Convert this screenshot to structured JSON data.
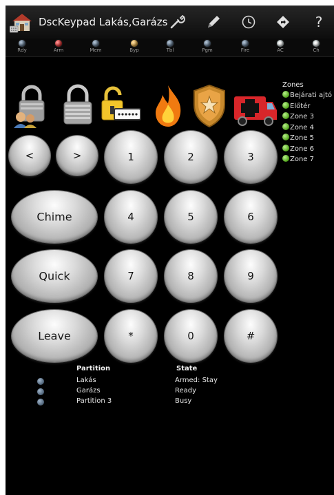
{
  "appbar": {
    "title": "DscKeypad Lakás,Garázs",
    "icons": [
      "app-icon",
      "wrench-icon",
      "pencil-icon",
      "clock-icon",
      "navigation-icon",
      "help-icon"
    ],
    "help_label": "?"
  },
  "indicators": [
    {
      "label": "Rdy",
      "color": "#5a6f85"
    },
    {
      "label": "Arm",
      "color": "#d42a2a"
    },
    {
      "label": "Mem",
      "color": "#5a6f85"
    },
    {
      "label": "Byp",
      "color": "#d9a441"
    },
    {
      "label": "Tbl",
      "color": "#5a6f85"
    },
    {
      "label": "Pgm",
      "color": "#5a6f85"
    },
    {
      "label": "Fire",
      "color": "#5a6f85"
    },
    {
      "label": "AC",
      "color": "#ffffff"
    },
    {
      "label": "Ch",
      "color": "#ffffff"
    }
  ],
  "actions": [
    "arm-stay-icon",
    "arm-away-icon",
    "code-entry-icon",
    "fire-icon",
    "police-icon",
    "ambulance-icon"
  ],
  "zones": {
    "title": "Zones",
    "items": [
      "Bejárati ajtó",
      "Előtér",
      "Zone 3",
      "Zone 4",
      "Zone 5",
      "Zone 6",
      "Zone 7"
    ]
  },
  "keypad": {
    "prev": "<",
    "next": ">",
    "k1": "1",
    "k2": "2",
    "k3": "3",
    "k4": "4",
    "k5": "5",
    "k6": "6",
    "k7": "7",
    "k8": "8",
    "k9": "9",
    "star": "*",
    "k0": "0",
    "hash": "#",
    "chime": "Chime",
    "quick": "Quick",
    "leave": "Leave"
  },
  "partitions": {
    "col_partition": "Partition",
    "col_state": "State",
    "rows": [
      {
        "name": "Lakás",
        "state": "Armed: Stay"
      },
      {
        "name": "Garázs",
        "state": "Ready"
      },
      {
        "name": "Partition 3",
        "state": "Busy"
      }
    ]
  }
}
